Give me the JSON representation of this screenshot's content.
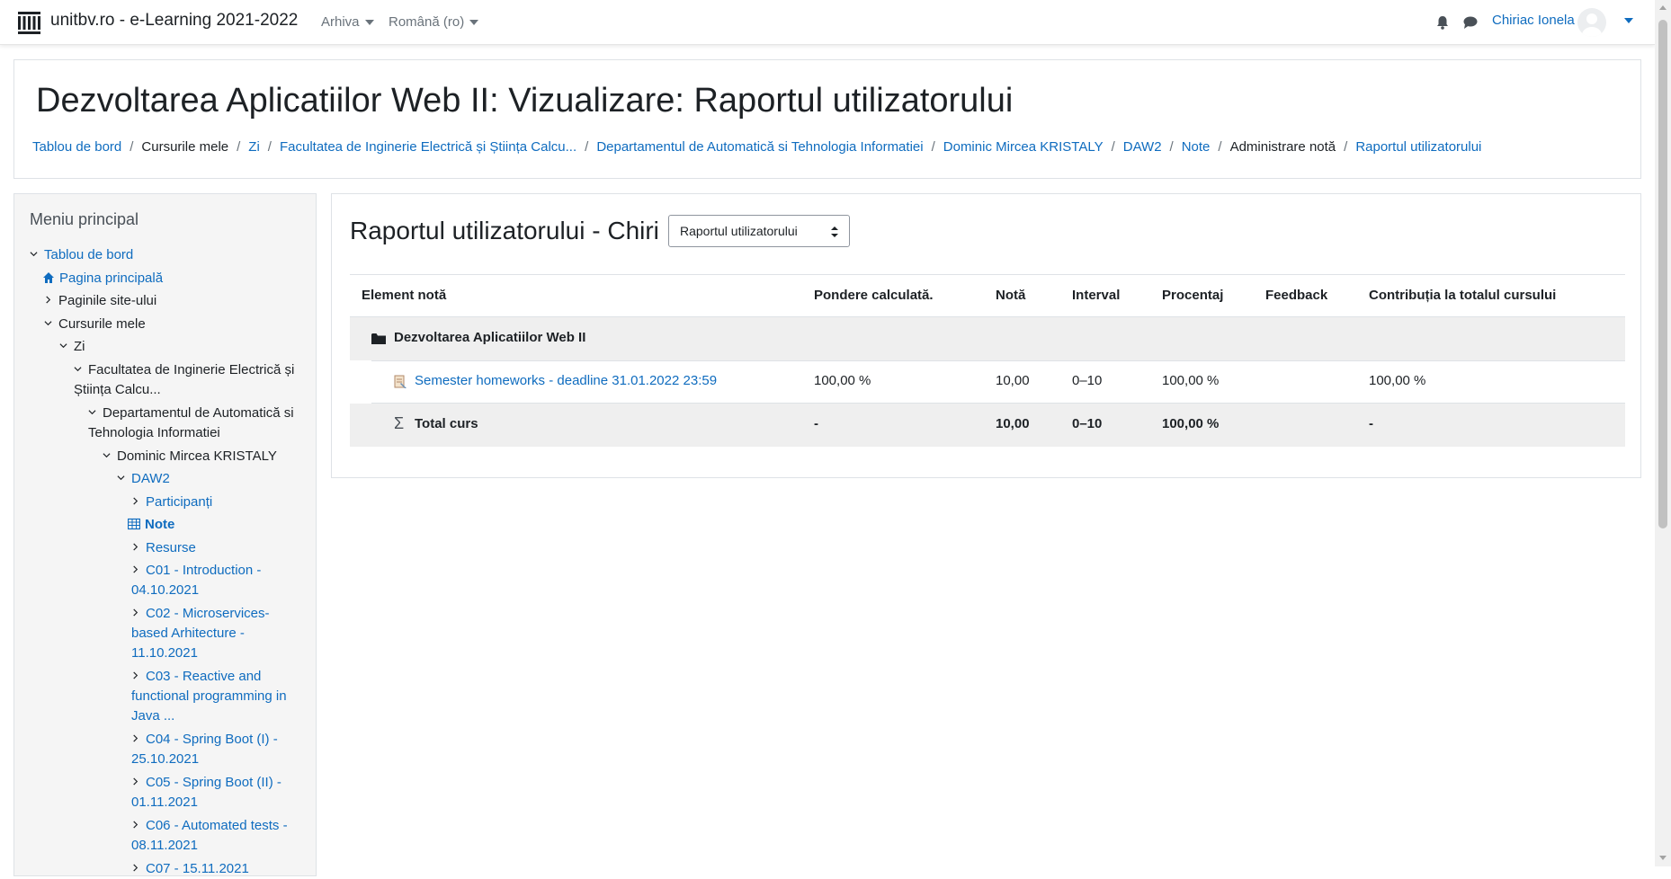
{
  "navbar": {
    "site_name": "unitbv.ro - e-Learning 2021-2022",
    "menu_archive": "Arhiva",
    "menu_language": "Română (ro)",
    "user_name": "Chiriac Ionela",
    "icons": [
      "institution-icon",
      "bell-icon",
      "chat-icon",
      "user-avatar",
      "caret-down-icon"
    ]
  },
  "header": {
    "title": "Dezvoltarea Aplicatiilor Web II: Vizualizare: Raportul utilizatorului",
    "breadcrumb": [
      "Tablou de bord",
      "Cursurile mele",
      "Zi",
      "Facultatea de Inginerie Electrică și Știința Calcu...",
      "Departamentul de Automatică si Tehnologia Informatiei",
      "Dominic Mircea KRISTALY",
      "DAW2",
      "Note",
      "Administrare notă",
      "Raportul utilizatorului"
    ],
    "separator": "/"
  },
  "sidebar": {
    "title": "Meniu principal",
    "items": [
      "Tablou de bord",
      "Pagina principală",
      "Paginile site-ului",
      "Cursurile mele",
      "Zi",
      "Facultatea de Inginerie Electrică și Știința Calcu...",
      "Departamentul de Automatică si Tehnologia Informatiei",
      "Dominic Mircea KRISTALY",
      "DAW2",
      "Participanți",
      "Note",
      "Resurse",
      "C01 - Introduction - 04.10.2021",
      "C02 - Microservices-based Arhitecture - 11.10.2021",
      "C03 - Reactive and functional programming in Java ...",
      "C04 - Spring Boot (I) - 25.10.2021",
      "C05 - Spring Boot (II) - 01.11.2021",
      "C06 - Automated tests - 08.11.2021",
      "C07 - 15.11.2021"
    ]
  },
  "report": {
    "title": "Raportul utilizatorului - Chiriac Ionela",
    "select_value": "Raportul utilizatorului",
    "columns": [
      "Element notă",
      "Pondere calculată.",
      "Notă",
      "Interval",
      "Procentaj",
      "Feedback",
      "Contribuția la totalul cursului"
    ],
    "category": "Dezvoltarea Aplicatiilor Web II",
    "item": {
      "name": "Semester homeworks - deadline 31.01.2022 23:59",
      "weight": "100,00 %",
      "grade": "10,00",
      "range": "0–10",
      "percentage": "100,00 %",
      "feedback": "",
      "contribution": "100,00 %"
    },
    "total": {
      "name": "Total curs",
      "weight": "-",
      "grade": "10,00",
      "range": "0–10",
      "percentage": "100,00 %",
      "feedback": "",
      "contribution": "-"
    }
  }
}
